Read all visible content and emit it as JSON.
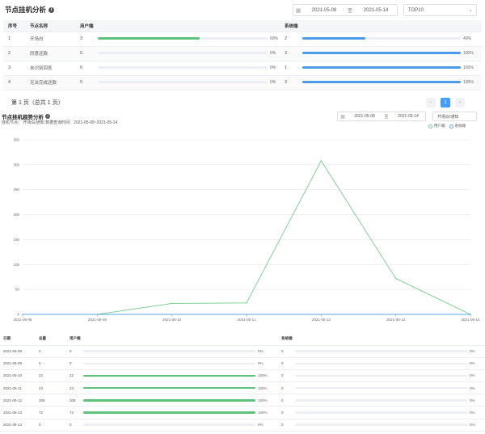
{
  "top": {
    "title": "节点挂机分析",
    "date_start": "2021-05-08",
    "date_sep": "至",
    "date_end": "2021-05-14",
    "top_select": "TOP10",
    "columns": [
      "序号",
      "节点名称",
      "用户端",
      "",
      "系统端",
      ""
    ],
    "rows": [
      {
        "idx": "1",
        "name": "开场白",
        "user_count": "3",
        "user_pct": "60%",
        "user_frac": 0.6,
        "sys_count": "2",
        "sys_pct": "40%",
        "sys_frac": 0.4
      },
      {
        "idx": "2",
        "name": "同意还款",
        "user_count": "0",
        "user_pct": "0%",
        "user_frac": 0,
        "sys_count": "3",
        "sys_pct": "100%",
        "sys_frac": 1
      },
      {
        "idx": "3",
        "name": "未识别回答",
        "user_count": "0",
        "user_pct": "0%",
        "user_frac": 0,
        "sys_count": "1",
        "sys_pct": "100%",
        "sys_frac": 1
      },
      {
        "idx": "4",
        "name": "无法完成还款",
        "user_count": "0",
        "user_pct": "0%",
        "user_frac": 0,
        "sys_count": "3",
        "sys_pct": "100%",
        "sys_frac": 1
      }
    ],
    "pager_text": "第 1 页（总共 1 页）",
    "page_current": "1"
  },
  "trend": {
    "title": "节点挂机趋势分析",
    "subtitle": "挂机节点：  开场白/通知  数据查询时间：2021-05-08~2021-05-14",
    "date_start": "2021-05-08",
    "date_sep": "至",
    "date_end": "2021-05-14",
    "node_select": "开场白/通知",
    "legend_user": "用户端",
    "legend_sys": "系统端"
  },
  "chart_data": {
    "type": "line",
    "x": [
      "2021-05-08",
      "2021-05-09",
      "2021-05-10",
      "2021-05-11",
      "2021-05-12",
      "2021-05-13",
      "2021-05-14"
    ],
    "yticks": [
      0,
      50,
      100,
      150,
      200,
      250,
      300,
      350
    ],
    "ylim": [
      0,
      350
    ],
    "grid": true,
    "legend_position": "top-right",
    "series": [
      {
        "name": "用户端",
        "values": [
          0,
          0,
          22,
          23,
          308,
          72,
          0
        ],
        "color": "#71cc8b"
      },
      {
        "name": "系统端",
        "values": [
          0,
          0,
          0,
          0,
          0,
          0,
          0
        ],
        "color": "#5aa5e6"
      }
    ]
  },
  "detail": {
    "columns": [
      "日期",
      "总量",
      "用户端",
      "",
      "系统端",
      ""
    ],
    "rows": [
      {
        "date": "2021-05-08",
        "total": "0",
        "user_count": "0",
        "user_pct": "0%",
        "user_frac": 0,
        "sys_count": "0",
        "sys_pct": "0%",
        "sys_frac": 0
      },
      {
        "date": "2021-05-09",
        "total": "0",
        "user_count": "0",
        "user_pct": "0%",
        "user_frac": 0,
        "sys_count": "0",
        "sys_pct": "0%",
        "sys_frac": 0
      },
      {
        "date": "2021-05-10",
        "total": "22",
        "user_count": "22",
        "user_pct": "100%",
        "user_frac": 1,
        "sys_count": "0",
        "sys_pct": "0%",
        "sys_frac": 0
      },
      {
        "date": "2021-05-11",
        "total": "23",
        "user_count": "23",
        "user_pct": "100%",
        "user_frac": 1,
        "sys_count": "0",
        "sys_pct": "0%",
        "sys_frac": 0
      },
      {
        "date": "2021-05-12",
        "total": "308",
        "user_count": "308",
        "user_pct": "100%",
        "user_frac": 1,
        "sys_count": "0",
        "sys_pct": "0%",
        "sys_frac": 0
      },
      {
        "date": "2021-05-13",
        "total": "72",
        "user_count": "72",
        "user_pct": "100%",
        "user_frac": 1,
        "sys_count": "0",
        "sys_pct": "0%",
        "sys_frac": 0
      },
      {
        "date": "2021-05-14",
        "total": "0",
        "user_count": "0",
        "user_pct": "0%",
        "user_frac": 0,
        "sys_count": "0",
        "sys_pct": "0%",
        "sys_frac": 0
      }
    ]
  },
  "colors": {
    "user_bar": "#5ec27a",
    "sys_bar": "#4a9be8",
    "accent": "#409eff"
  }
}
